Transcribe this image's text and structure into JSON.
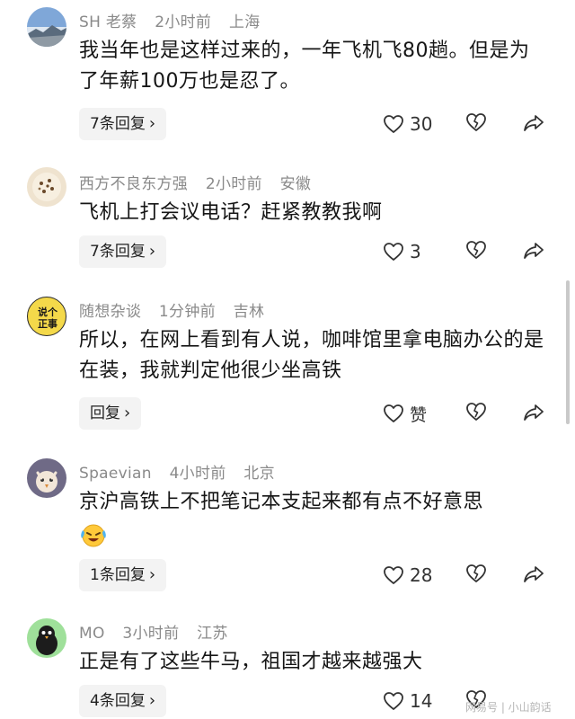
{
  "comments": [
    {
      "username": "SH 老蔡",
      "time": "2小时前",
      "location": "上海",
      "text": "我当年也是这样过来的，一年飞机飞80趟。但是为了年薪100万也是忍了。",
      "reply_label": "7条回复",
      "likes": "30"
    },
    {
      "username": "西方不良东方强",
      "time": "2小时前",
      "location": "安徽",
      "text": "飞机上打会议电话？赶紧教教我啊",
      "reply_label": "7条回复",
      "likes": "3"
    },
    {
      "username": "随想杂谈",
      "time": "1分钟前",
      "location": "吉林",
      "text": "所以，在网上看到有人说，咖啡馆里拿电脑办公的是在装，我就判定他很少坐高铁",
      "reply_label": "回复",
      "likes": "赞",
      "avatar_text": "说个正事"
    },
    {
      "username": "Spaevian",
      "time": "4小时前",
      "location": "北京",
      "text": "京沪高铁上不把笔记本支起来都有点不好意思",
      "reply_label": "1条回复",
      "likes": "28"
    },
    {
      "username": "MO",
      "time": "3小时前",
      "location": "江苏",
      "text": "正是有了这些牛马，祖国才越来越强大",
      "reply_label": "4条回复",
      "likes": "14"
    }
  ],
  "reply_chevron": "›",
  "watermark": "网易号 | 小山韵话",
  "icons": {
    "like": "heart-outline",
    "dislike": "broken-heart-outline",
    "share": "share-arrow"
  }
}
